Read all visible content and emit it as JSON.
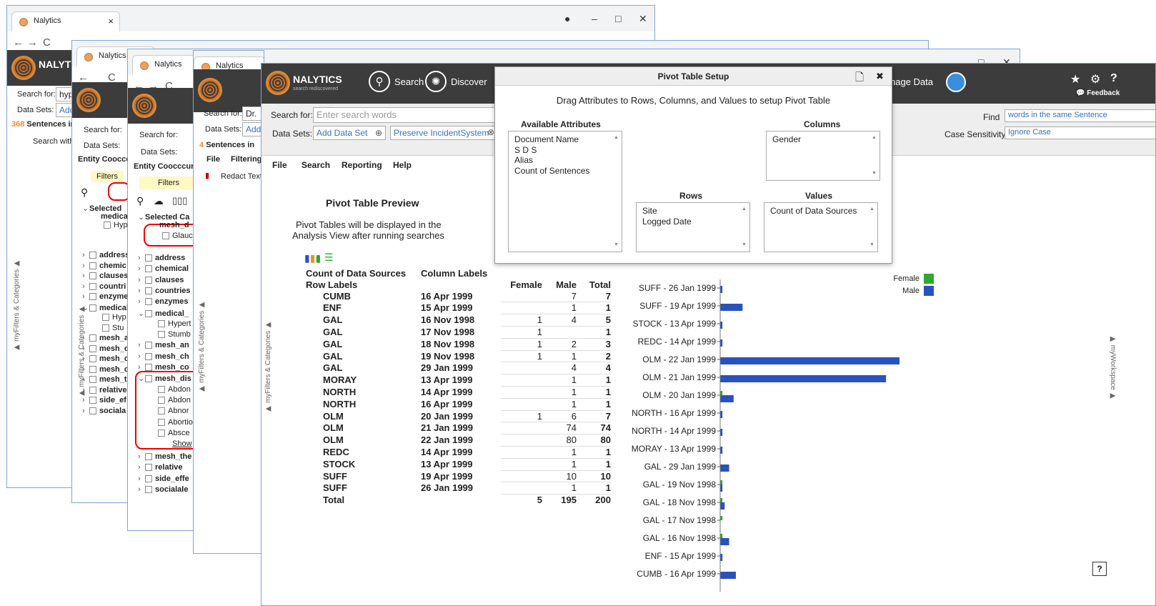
{
  "bg_windows": {
    "tab_title": "Nalytics",
    "w1": {
      "search_value": "hyp",
      "sentences_count": "368",
      "sentences_label": "Sentences in",
      "search_with": "Search with",
      "sidebar_label": "▶ myFilters & Categories ▶"
    },
    "w2": {
      "search_value": "\"",
      "entity_label": "Entity Coocccur",
      "filters": "Filters",
      "selected": "Selected",
      "medica": "medica",
      "hyp": "Hyp",
      "items": [
        "address",
        "chemic",
        "clauses",
        "countri",
        "enzyme",
        "medical"
      ],
      "sub_items": [
        "Hyp",
        "Stu"
      ],
      "items2": [
        "mesh_a",
        "mesh_c",
        "mesh_c",
        "mesh_c",
        "mesh_t",
        "relative",
        "side_ef",
        "sociala"
      ]
    },
    "w3": {
      "entity_label": "Entity Coocccurre",
      "filters": "Filters",
      "selected": "Selected Ca",
      "mesh_d": "mesh_d",
      "glauc": "Glauc",
      "items": [
        "address",
        "chemical",
        "clauses",
        "countries",
        "enzymes",
        "medical_"
      ],
      "sub_items": [
        "Hypert",
        "Stumb"
      ],
      "items2": [
        "mesh_an",
        "mesh_ch",
        "mesh_co",
        "mesh_dis"
      ],
      "sub_items2": [
        "Abdon",
        "Abdon",
        "Abnor",
        "Abortio",
        "Absce"
      ],
      "show": "Show",
      "items3": [
        "mesh_the",
        "relative",
        "side_effe",
        "socialale"
      ]
    },
    "w4": {
      "search_value": "Dr.",
      "data_sets_value": "Add",
      "sentences_label": "Sentences in",
      "sentences_count": "4",
      "menu_file": "File",
      "menu_filtering": "Filtering",
      "redact": "Redact Text",
      "sidebar_label": "▶ myFilters & Categories ▶"
    }
  },
  "main": {
    "brand": "NALYTICS",
    "brand_sub": "search rediscovered",
    "nav": {
      "search": "Search",
      "discover": "Discover",
      "manage": "nage Data",
      "feedback": "Feedback"
    },
    "search_for_label": "Search for:",
    "search_placeholder": "Enter search words",
    "data_sets_label": "Data Sets:",
    "add_data_set": "Add Data Set",
    "preserve": "Preserve IncidentSystem",
    "find_label": "Find",
    "find_value": "words in the same Sentence",
    "case_label": "Case Sensitivity:",
    "case_value": "Ignore Case",
    "menu": [
      "File",
      "Search",
      "Reporting",
      "Help"
    ],
    "left_sidebar": "▶ myFilters & Categories ▶",
    "right_sidebar": "▶ myWorkspace ▶",
    "help_glyph": "?",
    "preview_title": "Pivot Table Preview",
    "preview_note_1": "Pivot Tables will be displayed in the",
    "preview_note_2": "Analysis View after running searches",
    "colors": {
      "male": "#2a52be",
      "female": "#2ea82e",
      "bar": "#3c3c3c",
      "dialog_bg": "#eeeeee"
    }
  },
  "pivot": {
    "header_a": "Count of Data Sources",
    "header_b": "Column Labels",
    "row_labels": "Row Labels",
    "col_female": "Female",
    "col_male": "Male",
    "col_total": "Total",
    "rows": [
      {
        "site": "CUMB",
        "date": "16 Apr 1999",
        "female": "",
        "male": "7",
        "total": "7"
      },
      {
        "site": "ENF",
        "date": "15 Apr 1999",
        "female": "",
        "male": "1",
        "total": "1"
      },
      {
        "site": "GAL",
        "date": "16 Nov 1998",
        "female": "1",
        "male": "4",
        "total": "5"
      },
      {
        "site": "GAL",
        "date": "17 Nov 1998",
        "female": "1",
        "male": "",
        "total": "1"
      },
      {
        "site": "GAL",
        "date": "18 Nov 1998",
        "female": "1",
        "male": "2",
        "total": "3"
      },
      {
        "site": "GAL",
        "date": "19 Nov 1998",
        "female": "1",
        "male": "1",
        "total": "2"
      },
      {
        "site": "GAL",
        "date": "29 Jan 1999",
        "female": "",
        "male": "4",
        "total": "4"
      },
      {
        "site": "MORAY",
        "date": "13 Apr 1999",
        "female": "",
        "male": "1",
        "total": "1"
      },
      {
        "site": "NORTH",
        "date": "14 Apr 1999",
        "female": "",
        "male": "1",
        "total": "1"
      },
      {
        "site": "NORTH",
        "date": "16 Apr 1999",
        "female": "",
        "male": "1",
        "total": "1"
      },
      {
        "site": "OLM",
        "date": "20 Jan 1999",
        "female": "1",
        "male": "6",
        "total": "7"
      },
      {
        "site": "OLM",
        "date": "21 Jan 1999",
        "female": "",
        "male": "74",
        "total": "74"
      },
      {
        "site": "OLM",
        "date": "22 Jan 1999",
        "female": "",
        "male": "80",
        "total": "80"
      },
      {
        "site": "REDC",
        "date": "14 Apr 1999",
        "female": "",
        "male": "1",
        "total": "1"
      },
      {
        "site": "STOCK",
        "date": "13 Apr 1999",
        "female": "",
        "male": "1",
        "total": "1"
      },
      {
        "site": "SUFF",
        "date": "19 Apr 1999",
        "female": "",
        "male": "10",
        "total": "10"
      },
      {
        "site": "SUFF",
        "date": "26 Jan 1999",
        "female": "",
        "male": "1",
        "total": "1"
      }
    ],
    "total_label": "Total",
    "total_female": "5",
    "total_male": "195",
    "total_total": "200"
  },
  "dialog": {
    "title": "Pivot Table Setup",
    "close": "✖",
    "instructions": "Drag Attributes to Rows, Columns, and Values to setup Pivot Table",
    "available_label": "Available Attributes",
    "available": [
      "Document Name",
      "S D S",
      "Alias",
      "Count of Sentences"
    ],
    "columns_label": "Columns",
    "columns": [
      "Gender"
    ],
    "rows_label": "Rows",
    "rows": [
      "Site",
      "Logged Date"
    ],
    "values_label": "Values",
    "values": [
      "Count of Data Sources"
    ]
  },
  "chart_data": {
    "type": "bar",
    "orientation": "horizontal",
    "categories": [
      "SUFF - 26 Jan 1999",
      "SUFF - 19 Apr 1999",
      "STOCK - 13 Apr 1999",
      "REDC - 14 Apr 1999",
      "OLM - 22 Jan 1999",
      "OLM - 21 Jan 1999",
      "OLM - 20 Jan 1999",
      "NORTH - 16 Apr 1999",
      "NORTH - 14 Apr 1999",
      "MORAY - 13 Apr 1999",
      "GAL - 29 Jan 1999",
      "GAL - 19 Nov 1998",
      "GAL - 18 Nov 1998",
      "GAL - 17 Nov 1998",
      "GAL - 16 Nov 1998",
      "ENF - 15 Apr 1999",
      "CUMB - 16 Apr 1999"
    ],
    "series": [
      {
        "name": "Female",
        "values": [
          0,
          0,
          0,
          0,
          0,
          0,
          1,
          0,
          0,
          0,
          0,
          1,
          1,
          1,
          1,
          0,
          0
        ]
      },
      {
        "name": "Male",
        "values": [
          1,
          10,
          1,
          1,
          80,
          74,
          6,
          1,
          1,
          1,
          4,
          1,
          2,
          0,
          4,
          1,
          7
        ]
      }
    ],
    "xlim": [
      0,
      80
    ],
    "legend": "top-right",
    "grid": false
  }
}
